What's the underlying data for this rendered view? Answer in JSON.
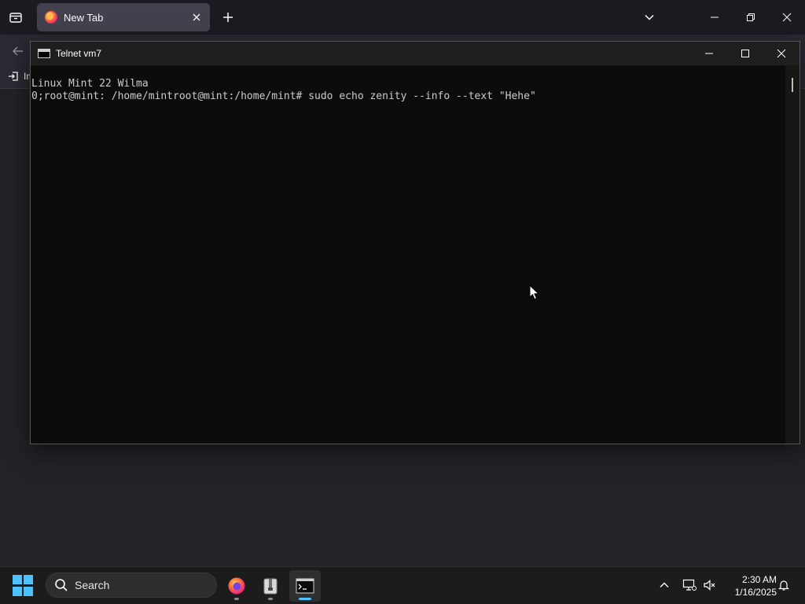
{
  "browser": {
    "tab": {
      "title": "New Tab"
    },
    "bookmarks": {
      "import_label": "Im"
    }
  },
  "console": {
    "title": "Telnet vm7",
    "lines": [
      "Linux Mint 22 Wilma",
      "0;root@mint: /home/mintroot@mint:/home/mint# sudo echo zenity --info --text \"Hehe\""
    ]
  },
  "taskbar": {
    "search_label": "Search",
    "apps": [
      "firefox-icon",
      "archive-manager-icon",
      "terminal-icon"
    ],
    "clock": {
      "time": "2:30 AM",
      "date": "1/16/2025"
    }
  },
  "colors": {
    "accent": "#4cc2ff",
    "console_bg": "#0c0c0c",
    "console_text": "#cccccc",
    "browser_bg": "#2b2a33"
  }
}
